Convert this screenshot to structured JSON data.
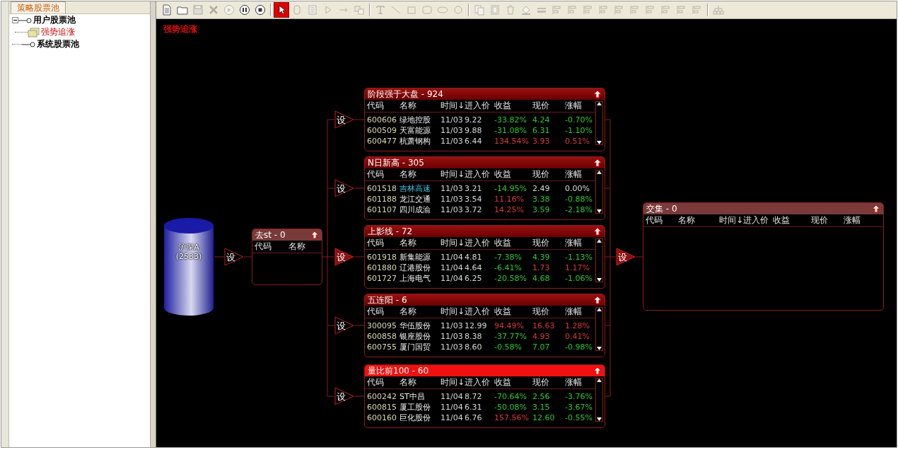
{
  "sidebar": {
    "tab": "策略股票池",
    "tree": [
      {
        "label": "用户股票池",
        "expanded": true,
        "selected": false,
        "children": [
          {
            "label": "强势追涨",
            "selected": true
          }
        ]
      },
      {
        "label": "系统股票池",
        "selected": false
      }
    ]
  },
  "toolbar": [
    [
      {
        "kind": "document",
        "disabled": false,
        "selected": false
      },
      {
        "kind": "folder",
        "disabled": false,
        "selected": false
      },
      {
        "kind": "save",
        "disabled": true,
        "selected": false
      },
      {
        "kind": "delete",
        "disabled": true,
        "selected": false
      },
      {
        "kind": "play",
        "disabled": true,
        "selected": false
      },
      {
        "kind": "pause",
        "disabled": false,
        "selected": false
      },
      {
        "kind": "stop",
        "disabled": false,
        "selected": false
      }
    ],
    [
      {
        "kind": "pointer",
        "disabled": false,
        "selected": true
      },
      {
        "kind": "capsule",
        "disabled": true,
        "selected": false
      },
      {
        "kind": "list",
        "disabled": true,
        "selected": false
      },
      {
        "kind": "triangle",
        "disabled": true,
        "selected": false
      },
      {
        "kind": "arrow",
        "disabled": true,
        "selected": false
      },
      {
        "kind": "group",
        "disabled": true,
        "selected": false
      }
    ],
    [
      {
        "kind": "text",
        "disabled": true,
        "selected": false
      },
      {
        "kind": "line",
        "disabled": true,
        "selected": false
      },
      {
        "kind": "rectangle",
        "disabled": true,
        "selected": false
      },
      {
        "kind": "rounded",
        "disabled": true,
        "selected": false
      },
      {
        "kind": "ellipse",
        "disabled": true,
        "selected": false
      },
      {
        "kind": "circle",
        "disabled": true,
        "selected": false
      }
    ],
    [
      {
        "kind": "copy",
        "disabled": true,
        "selected": false
      },
      {
        "kind": "paste",
        "disabled": true,
        "selected": false
      },
      {
        "kind": "trash",
        "disabled": true,
        "selected": false
      },
      {
        "kind": "fill",
        "disabled": true,
        "selected": false
      },
      {
        "kind": "stroke",
        "disabled": true,
        "selected": false
      },
      {
        "kind": "align",
        "disabled": true,
        "selected": false
      },
      {
        "kind": "align",
        "disabled": true,
        "selected": false
      },
      {
        "kind": "align",
        "disabled": true,
        "selected": false
      },
      {
        "kind": "align",
        "disabled": true,
        "selected": false
      },
      {
        "kind": "align",
        "disabled": true,
        "selected": false
      },
      {
        "kind": "align",
        "disabled": true,
        "selected": false
      },
      {
        "kind": "align",
        "disabled": true,
        "selected": false
      },
      {
        "kind": "align",
        "disabled": true,
        "selected": false
      },
      {
        "kind": "align",
        "disabled": true,
        "selected": false
      },
      {
        "kind": "align",
        "disabled": true,
        "selected": false
      }
    ],
    [
      {
        "kind": "network",
        "disabled": true,
        "selected": false
      }
    ]
  ],
  "canvas": {
    "title": "强势追涨",
    "source": {
      "label": "沪深A",
      "count": "(2533)"
    },
    "gates": [
      {
        "label": "设",
        "kind": "outline"
      },
      {
        "label": "设",
        "kind": "outline"
      },
      {
        "label": "设",
        "kind": "outline"
      },
      {
        "label": "设",
        "kind": "filled"
      },
      {
        "label": "设",
        "kind": "outline"
      },
      {
        "label": "设",
        "kind": "outline"
      },
      {
        "label": "设",
        "kind": "filled"
      }
    ],
    "filter": {
      "title": "去st - 0",
      "columns": [
        "代码",
        "名称"
      ]
    },
    "cards": [
      {
        "title": "阶段强于大盘 - 924",
        "selected": false,
        "columns": [
          "代码",
          "名称",
          "时间↓",
          "进入价",
          "收益",
          "现价",
          "涨幅"
        ],
        "rows": [
          {
            "code": "600606",
            "name": "绿地控股",
            "highlighted": false,
            "time": "11/03",
            "entry": "9.22",
            "gain": {
              "text": "-33.82%",
              "color": "#2ec82e"
            },
            "price": {
              "text": "4.24",
              "color": "#2ec82e"
            },
            "change": {
              "text": "-0.70%",
              "color": "#2ec82e"
            }
          },
          {
            "code": "600509",
            "name": "天富能源",
            "highlighted": false,
            "time": "11/03",
            "entry": "9.88",
            "gain": {
              "text": "-31.08%",
              "color": "#2ec82e"
            },
            "price": {
              "text": "6.31",
              "color": "#2ec82e"
            },
            "change": {
              "text": "-1.10%",
              "color": "#2ec82e"
            }
          },
          {
            "code": "600477",
            "name": "杭萧钢构",
            "highlighted": false,
            "time": "11/03",
            "entry": "6.44",
            "gain": {
              "text": "134.54%",
              "color": "#d83838"
            },
            "price": {
              "text": "3.93",
              "color": "#d83838"
            },
            "change": {
              "text": "0.51%",
              "color": "#d83838"
            }
          }
        ]
      },
      {
        "title": "N日新高 - 305",
        "selected": false,
        "columns": [
          "代码",
          "名称",
          "时间↓",
          "进入价",
          "收益",
          "现价",
          "涨幅"
        ],
        "rows": [
          {
            "code": "601518",
            "name": "吉林高速",
            "highlighted": true,
            "time": "11/03",
            "entry": "3.21",
            "gain": {
              "text": "-14.95%",
              "color": "#2ec82e"
            },
            "price": {
              "text": "2.49",
              "color": "#d8d8d8"
            },
            "change": {
              "text": "0.00%",
              "color": "#d8d8d8"
            }
          },
          {
            "code": "601188",
            "name": "龙江交通",
            "highlighted": false,
            "time": "11/03",
            "entry": "3.54",
            "gain": {
              "text": "11.16%",
              "color": "#d83838"
            },
            "price": {
              "text": "3.38",
              "color": "#2ec82e"
            },
            "change": {
              "text": "-0.88%",
              "color": "#2ec82e"
            }
          },
          {
            "code": "601107",
            "name": "四川成渝",
            "highlighted": false,
            "time": "11/03",
            "entry": "3.72",
            "gain": {
              "text": "14.25%",
              "color": "#d83838"
            },
            "price": {
              "text": "3.59",
              "color": "#2ec82e"
            },
            "change": {
              "text": "-2.18%",
              "color": "#2ec82e"
            }
          }
        ]
      },
      {
        "title": "上影线 - 72",
        "selected": false,
        "columns": [
          "代码",
          "名称",
          "时间↓",
          "进入价",
          "收益",
          "现价",
          "涨幅"
        ],
        "rows": [
          {
            "code": "601918",
            "name": "新集能源",
            "highlighted": false,
            "time": "11/04",
            "entry": "4.81",
            "gain": {
              "text": "-7.38%",
              "color": "#2ec82e"
            },
            "price": {
              "text": "4.39",
              "color": "#2ec82e"
            },
            "change": {
              "text": "-1.13%",
              "color": "#2ec82e"
            }
          },
          {
            "code": "601880",
            "name": "辽港股份",
            "highlighted": false,
            "time": "11/04",
            "entry": "4.64",
            "gain": {
              "text": "-6.41%",
              "color": "#2ec82e"
            },
            "price": {
              "text": "1.73",
              "color": "#d83838"
            },
            "change": {
              "text": "1.17%",
              "color": "#d83838"
            }
          },
          {
            "code": "601727",
            "name": "上海电气",
            "highlighted": false,
            "time": "11/04",
            "entry": "6.25",
            "gain": {
              "text": "-20.58%",
              "color": "#2ec82e"
            },
            "price": {
              "text": "4.68",
              "color": "#2ec82e"
            },
            "change": {
              "text": "-1.06%",
              "color": "#2ec82e"
            }
          }
        ]
      },
      {
        "title": "五连阳 - 6",
        "selected": false,
        "columns": [
          "代码",
          "名称",
          "时间↓",
          "进入价",
          "收益",
          "现价",
          "涨幅"
        ],
        "rows": [
          {
            "code": "300095",
            "name": "华伍股份",
            "highlighted": false,
            "time": "11/03",
            "entry": "12.99",
            "gain": {
              "text": "94.49%",
              "color": "#d83838"
            },
            "price": {
              "text": "16.63",
              "color": "#d83838"
            },
            "change": {
              "text": "1.28%",
              "color": "#d83838"
            }
          },
          {
            "code": "600858",
            "name": "银座股份",
            "highlighted": false,
            "time": "11/03",
            "entry": "8.38",
            "gain": {
              "text": "-37.77%",
              "color": "#2ec82e"
            },
            "price": {
              "text": "4.93",
              "color": "#d83838"
            },
            "change": {
              "text": "0.41%",
              "color": "#d83838"
            }
          },
          {
            "code": "600755",
            "name": "厦门国贸",
            "highlighted": false,
            "time": "11/03",
            "entry": "8.60",
            "gain": {
              "text": "-0.58%",
              "color": "#2ec82e"
            },
            "price": {
              "text": "7.07",
              "color": "#2ec82e"
            },
            "change": {
              "text": "-0.98%",
              "color": "#2ec82e"
            }
          }
        ]
      },
      {
        "title": "量比前100 - 60",
        "selected": true,
        "columns": [
          "代码",
          "名称",
          "时间↓",
          "进入价",
          "收益",
          "现价",
          "涨幅"
        ],
        "rows": [
          {
            "code": "600242",
            "name": "ST中昌",
            "highlighted": false,
            "time": "11/04",
            "entry": "8.72",
            "gain": {
              "text": "-70.64%",
              "color": "#2ec82e"
            },
            "price": {
              "text": "2.56",
              "color": "#2ec82e"
            },
            "change": {
              "text": "-3.76%",
              "color": "#2ec82e"
            }
          },
          {
            "code": "600815",
            "name": "厦工股份",
            "highlighted": false,
            "time": "11/04",
            "entry": "6.31",
            "gain": {
              "text": "-50.08%",
              "color": "#2ec82e"
            },
            "price": {
              "text": "3.15",
              "color": "#2ec82e"
            },
            "change": {
              "text": "-3.67%",
              "color": "#2ec82e"
            }
          },
          {
            "code": "600160",
            "name": "巨化股份",
            "highlighted": false,
            "time": "11/04",
            "entry": "6.76",
            "gain": {
              "text": "157.56%",
              "color": "#d83838"
            },
            "price": {
              "text": "12.60",
              "color": "#2ec82e"
            },
            "change": {
              "text": "-0.55%",
              "color": "#2ec82e"
            }
          }
        ]
      }
    ],
    "result": {
      "title": "交集 - 0",
      "columns": [
        "代码",
        "名称",
        "时间↓",
        "进入价",
        "收益",
        "现价",
        "涨幅"
      ]
    }
  }
}
